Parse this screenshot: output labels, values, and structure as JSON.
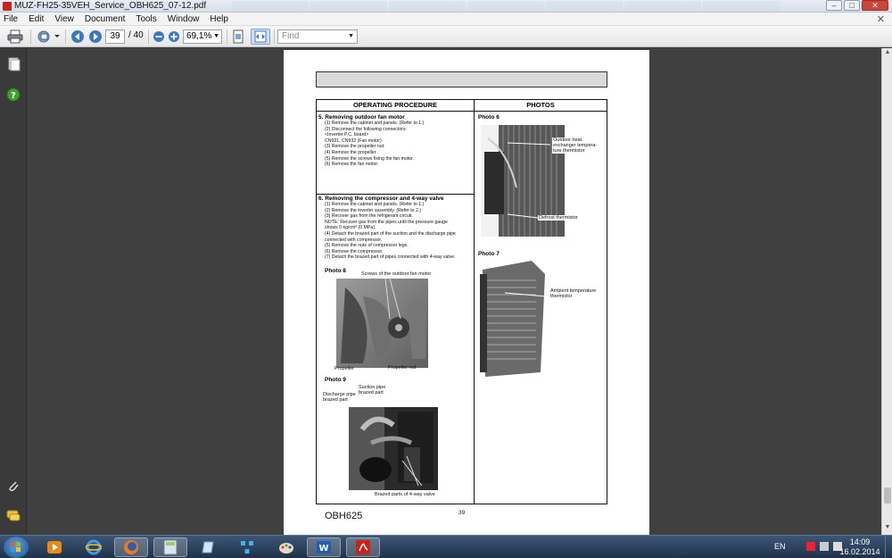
{
  "window": {
    "title": "MUZ-FH25-35VEH_Service_OBH625_07-12.pdf",
    "minimize": "–",
    "maximize": "□",
    "close": "✕"
  },
  "menu": {
    "items": [
      "File",
      "Edit",
      "View",
      "Document",
      "Tools",
      "Window",
      "Help"
    ],
    "close_doc": "✕"
  },
  "toolbar": {
    "current_page": "39",
    "total_pages": "/ 40",
    "zoom": "69,1%",
    "find_placeholder": "Find"
  },
  "nav_icons": [
    "pages-icon",
    "help-icon",
    "attachment-icon",
    "comments-icon"
  ],
  "document": {
    "header_left": "OPERATING PROCEDURE",
    "header_right": "PHOTOS",
    "section5": {
      "title": "5. Removing outdoor fan motor",
      "lines": [
        "(1) Remove the cabinet and panels. (Refer to 1.)",
        "(2) Disconnect the following connectors:",
        "      <Inverter P.C. board>",
        "      CN931, CN932 (Fan motor)",
        "(3) Remove the propeller nut.",
        "(4) Remove the propeller.",
        "(5) Remove the screws fixing the fan motor.",
        "(6) Remove the fan motor."
      ]
    },
    "section6": {
      "title": "6. Removing the compressor and 4-way valve",
      "lines": [
        "(1) Remove the cabinet and panels. (Refer to 1.)",
        "(2) Remove the inverter assembly. (Refer to 2.)",
        "(3) Recover gas from the refrigerant circuit.",
        "      NOTE: Recover gas from the pipes until the pressure gauge",
        "               shows 0 kg/cm² (0 MPa).",
        "(4) Detach the brazed part of the suction and the discharge pipe",
        "      connected with compressor.",
        "(5) Remove the nuts of compressor legs.",
        "(6) Remove the compressor.",
        "(7) Detach the brazed part of pipes connected with 4-way valve."
      ]
    },
    "photo8": {
      "label": "Photo 8",
      "cap_top": "Screws of the outdoor fan motor",
      "cap_left": "Propeller",
      "cap_right": "Propeller nut"
    },
    "photo9": {
      "label": "Photo 9",
      "cap_suction": "Suction pipe\nbrazed part",
      "cap_discharge": "Discharge pipe\nbrazed part",
      "cap_bottom": "Brazed parts of 4-way valve"
    },
    "photo6": {
      "label": "Photo 6",
      "cap_outdoor": "Outdoor heat\nexchanger tempera-\nture thermistor",
      "cap_defrost": "Defrost thermistor"
    },
    "photo7": {
      "label": "Photo 7",
      "cap_ambient": "Ambient temperature\nthermistor"
    },
    "footer_id": "OBH625",
    "page_number": "39"
  },
  "taskbar": {
    "lang": "EN",
    "time": "14:09",
    "date": "16.02.2014"
  }
}
